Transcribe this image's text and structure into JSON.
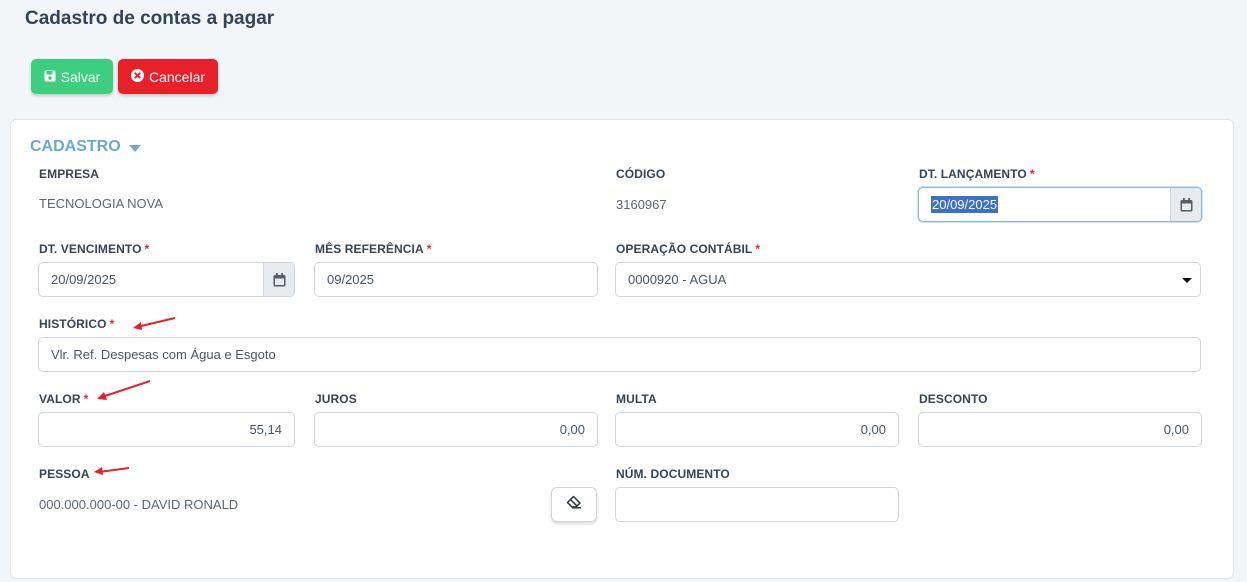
{
  "page": {
    "title": "Cadastro de contas a pagar"
  },
  "toolbar": {
    "save_label": "Salvar",
    "cancel_label": "Cancelar"
  },
  "section": {
    "title": "CADASTRO"
  },
  "fields": {
    "empresa": {
      "label": "EMPRESA",
      "value": "TECNOLOGIA NOVA"
    },
    "codigo": {
      "label": "CÓDIGO",
      "value": "3160967"
    },
    "dt_lancamento": {
      "label": "DT. LANÇAMENTO",
      "required": "*",
      "value": "20/09/2025"
    },
    "dt_vencimento": {
      "label": "DT. VENCIMENTO",
      "required": "*",
      "value": "20/09/2025"
    },
    "mes_referencia": {
      "label": "MÊS REFERÊNCIA",
      "required": "*",
      "value": "09/2025"
    },
    "operacao_contabil": {
      "label": "OPERAÇÃO CONTÁBIL",
      "required": "*",
      "value": "0000920 - AGUA"
    },
    "historico": {
      "label": "HISTÓRICO",
      "required": "*",
      "value": "Vlr. Ref. Despesas com Água e Esgoto"
    },
    "valor": {
      "label": "VALOR",
      "required": "*",
      "value": "55,14"
    },
    "juros": {
      "label": "JUROS",
      "value": "0,00"
    },
    "multa": {
      "label": "MULTA",
      "value": "0,00"
    },
    "desconto": {
      "label": "DESCONTO",
      "value": "0,00"
    },
    "pessoa": {
      "label": "PESSOA",
      "value": "000.000.000-00 - DAVID RONALD"
    },
    "num_documento": {
      "label": "NÚM. DOCUMENTO",
      "value": ""
    }
  },
  "icons": {
    "save": "floppy-disk-icon",
    "cancel": "times-circle-icon",
    "calendar": "calendar-icon",
    "eraser": "eraser-icon",
    "annotation": "red-arrow"
  },
  "colors": {
    "save_button": "#3ccf7f",
    "cancel_button": "#e8202a",
    "section_title": "#6aa9cf",
    "required": "#e8202a",
    "annotation_arrow": "#e8202a"
  }
}
